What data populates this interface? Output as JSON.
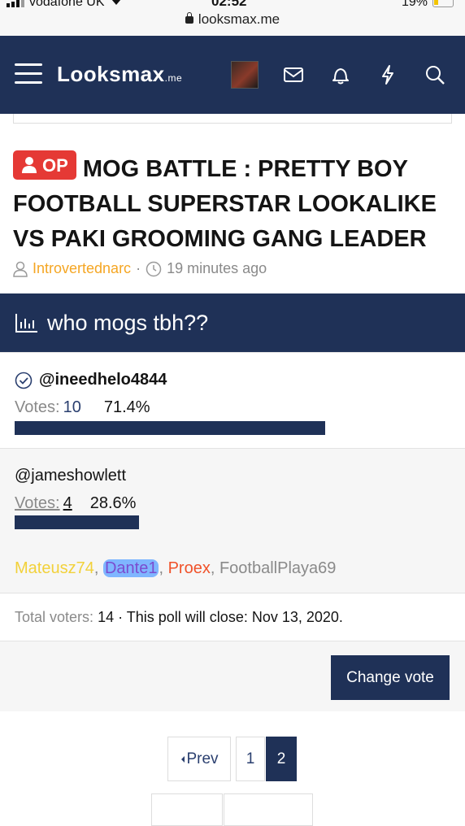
{
  "status": {
    "carrier": "vodafone UK",
    "time": "02:52",
    "battery": "19%"
  },
  "browser": {
    "url": "looksmax.me"
  },
  "nav": {
    "logo": "Looksmax",
    "logo_suffix": ".me"
  },
  "thread": {
    "badge": "OP",
    "title": "MOG BATTLE : PRETTY BOY FOOTBALL SUPERSTAR LOOKALIKE VS PAKI GROOMING GANG LEADER",
    "author": "Introvertednarc",
    "separator": "·",
    "time_ago": "19 minutes ago"
  },
  "poll": {
    "question": "who mogs tbh??",
    "options": [
      {
        "name": "@ineedhelo4844",
        "votes_label": "Votes:",
        "votes": "10",
        "percent": "71.4%",
        "fraction": 0.714,
        "selected": true
      },
      {
        "name": "@jameshowlett",
        "votes_label": "Votes:",
        "votes": "4",
        "percent": "28.6%",
        "fraction": 0.286,
        "selected": false
      }
    ],
    "voters": [
      "Mateusz74",
      "Dante1",
      "Proex",
      "FootballPlaya69"
    ],
    "voter_sep": ",",
    "total_label": "Total voters:",
    "total": "14",
    "close_text": "· This poll will close: Nov 13, 2020.",
    "change_vote_label": "Change vote"
  },
  "pagination": {
    "prev_label": "Prev",
    "pages": [
      "1",
      "2"
    ],
    "current": "2"
  },
  "colors": {
    "brand": "#1f3157",
    "op_badge": "#e53935",
    "author": "#f5a623"
  }
}
